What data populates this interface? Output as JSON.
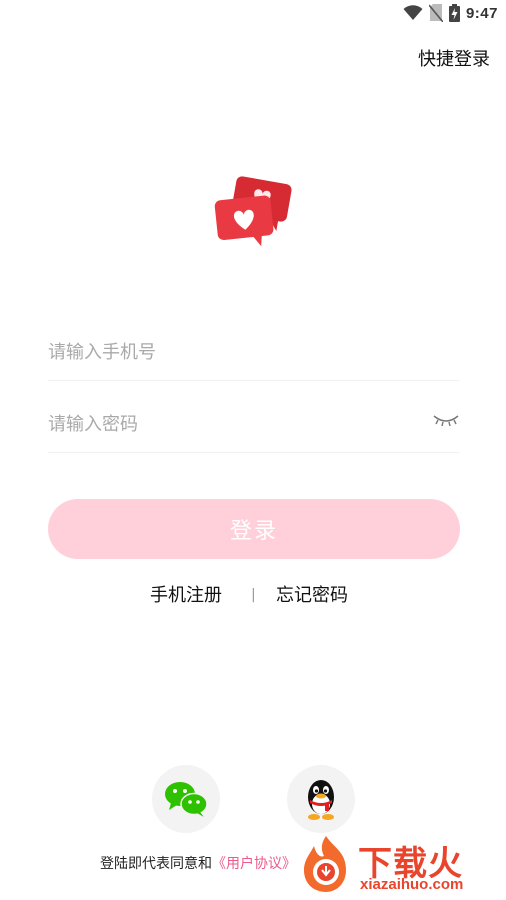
{
  "status_bar": {
    "time": "9:47"
  },
  "header": {
    "quick_login": "快捷登录"
  },
  "form": {
    "phone_placeholder": "请输入手机号",
    "password_placeholder": "请输入密码",
    "login_button": "登录"
  },
  "links": {
    "register": "手机注册",
    "separator": "|",
    "forgot_password": "忘记密码"
  },
  "social": {
    "icons": [
      "wechat-icon",
      "qq-icon"
    ]
  },
  "agreement": {
    "prefix": "登陆即代表同意和",
    "link": "《用户协议》"
  },
  "watermark": {
    "title": "下载火",
    "url": "xiazaihuo.com"
  },
  "colors": {
    "login_button_bg": "#ffd0d9",
    "agreement_link": "#ee5a8a",
    "watermark": "#e8452c"
  }
}
